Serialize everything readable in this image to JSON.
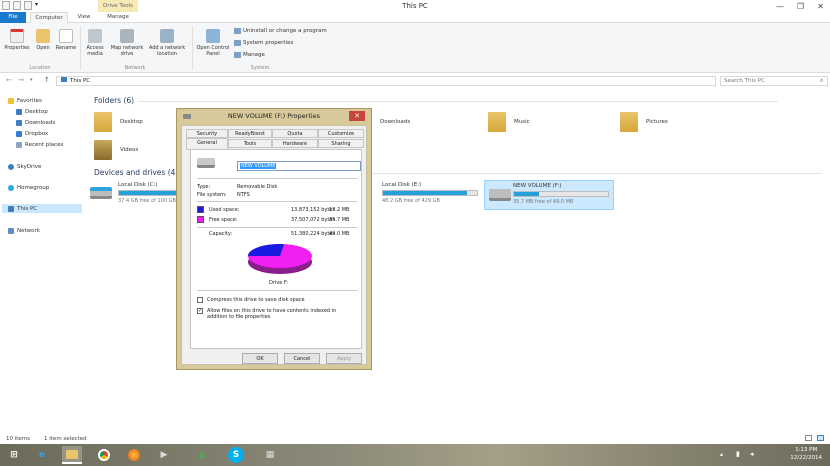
{
  "window": {
    "title": "This PC",
    "context_tab": "Drive Tools",
    "minimize": "—",
    "restore": "❐",
    "close": "✕"
  },
  "ribbon_tabs": [
    {
      "label": "File"
    },
    {
      "label": "Computer"
    },
    {
      "label": "View"
    },
    {
      "label": "Manage"
    }
  ],
  "ribbon": {
    "location": {
      "group": "Location",
      "properties": "Properties",
      "open": "Open",
      "rename": "Rename"
    },
    "network": {
      "group": "Network",
      "access_media": "Access media",
      "map_drive": "Map network drive",
      "add_location": "Add a network location"
    },
    "system": {
      "group": "System",
      "open_control_panel": "Open Control Panel",
      "uninstall": "Uninstall or change a program",
      "system_properties": "System properties",
      "manage": "Manage"
    }
  },
  "address": {
    "path": "This PC",
    "search_placeholder": "Search This PC"
  },
  "nav": {
    "favorites": "Favorites",
    "desktop": "Desktop",
    "downloads": "Downloads",
    "dropbox": "Dropbox",
    "recent": "Recent places",
    "skydrive": "SkyDrive",
    "homegroup": "Homegroup",
    "thispc": "This PC",
    "network": "Network"
  },
  "folders": {
    "header": "Folders (6)",
    "items": [
      "Desktop",
      "Downloads",
      "Music",
      "Pictures",
      "Videos"
    ]
  },
  "drives": {
    "header": "Devices and drives (4)",
    "c": {
      "name": "Local Disk (C:)",
      "free": "37.4 GB free of 100 GB",
      "used_fraction": 0.63
    },
    "e": {
      "name": "Local Disk (E:)",
      "free": "48.2 GB free of 429 GB",
      "used_fraction": 0.89
    },
    "f": {
      "name": "NEW VOLUME (F:)",
      "free": "35.7 MB free of 49.0 MB",
      "used_fraction": 0.27
    }
  },
  "status": {
    "items": "10 items",
    "selected": "1 item selected"
  },
  "taskbar": {
    "time": "1:13 PM",
    "date": "12/22/2014"
  },
  "dialog": {
    "title": "NEW VOLUME (F:) Properties",
    "tabs_row1": [
      "Security",
      "ReadyBoost",
      "Quota",
      "Customize"
    ],
    "tabs_row2": [
      "General",
      "Tools",
      "Hardware",
      "Sharing"
    ],
    "volume_name": "NEW VOLUME",
    "type_label": "Type:",
    "type_value": "Removable Disk",
    "fs_label": "File system:",
    "fs_value": "NTFS",
    "used_label": "Used space:",
    "used_bytes": "13,873,152 bytes",
    "used_size": "13.2 MB",
    "free_label": "Free space:",
    "free_bytes": "37,507,072 bytes",
    "free_size": "35.7 MB",
    "capacity_label": "Capacity:",
    "capacity_bytes": "51,380,224 bytes",
    "capacity_size": "49.0 MB",
    "drive_label": "Drive F:",
    "used_fraction": 0.27,
    "compress": "Compress this drive to save disk space",
    "index": "Allow files on this drive to have contents indexed in addition to file properties",
    "compress_checked": false,
    "index_checked": true,
    "ok": "OK",
    "cancel": "Cancel",
    "apply": "Apply",
    "colors": {
      "used": "#1a1ae0",
      "free": "#f21ff2"
    }
  }
}
